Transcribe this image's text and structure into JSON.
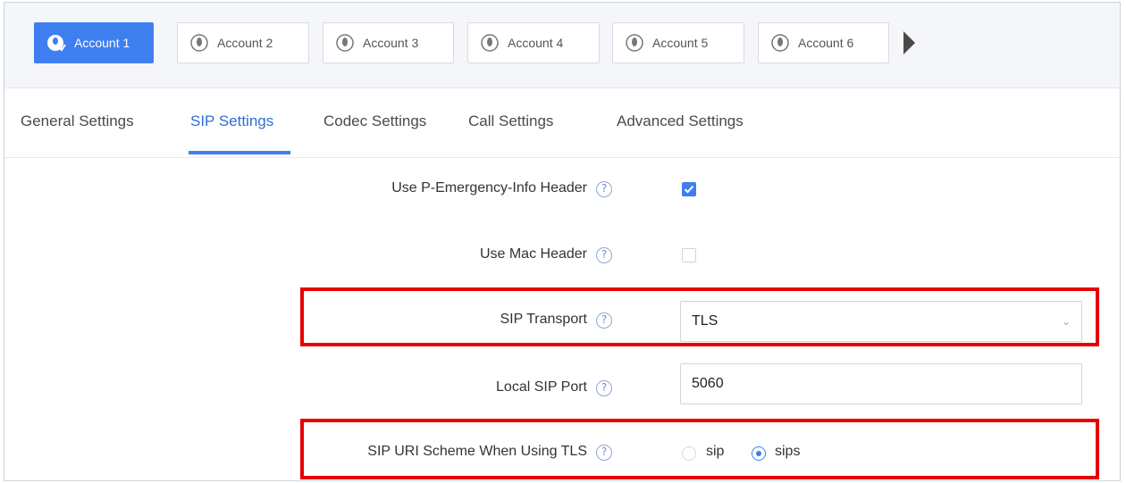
{
  "accounts": {
    "tabs": [
      {
        "label": "Account 1",
        "active": true
      },
      {
        "label": "Account 2",
        "active": false
      },
      {
        "label": "Account 3",
        "active": false
      },
      {
        "label": "Account 4",
        "active": false
      },
      {
        "label": "Account 5",
        "active": false
      },
      {
        "label": "Account 6",
        "active": false
      }
    ],
    "icon": "user-circle-icon",
    "next_icon": "arrow-right-icon"
  },
  "settings_tabs": [
    {
      "label": "General Settings",
      "active": false
    },
    {
      "label": "SIP Settings",
      "active": true
    },
    {
      "label": "Codec Settings",
      "active": false
    },
    {
      "label": "Call Settings",
      "active": false
    },
    {
      "label": "Advanced Settings",
      "active": false
    }
  ],
  "form": {
    "p_emergency": {
      "label": "Use P-Emergency-Info Header",
      "checked": true
    },
    "mac_header": {
      "label": "Use Mac Header",
      "checked": false
    },
    "sip_transport": {
      "label": "SIP Transport",
      "value": "TLS"
    },
    "local_sip_port": {
      "label": "Local SIP Port",
      "value": "5060"
    },
    "uri_scheme": {
      "label": "SIP URI Scheme When Using TLS",
      "options": [
        "sip",
        "sips"
      ],
      "selected": "sips"
    }
  },
  "help_icon": "?",
  "colors": {
    "accent": "#3e7ff0",
    "highlight": "#e60000"
  }
}
